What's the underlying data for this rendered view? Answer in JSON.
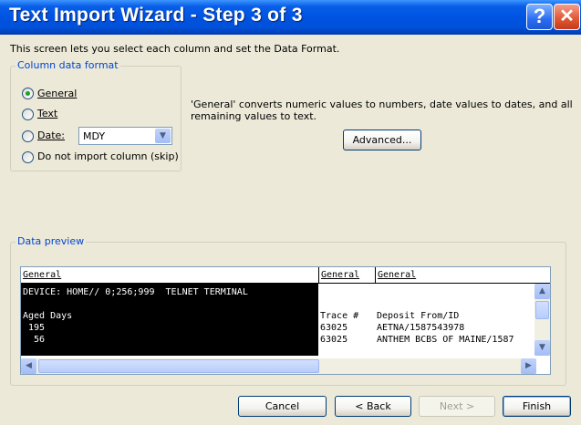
{
  "window": {
    "title": "Text Import Wizard - Step 3 of 3",
    "help_glyph": "?",
    "close_glyph": "✕"
  },
  "instruction": "This screen lets you select each column and set the Data Format.",
  "column_format": {
    "legend": "Column data format",
    "options": [
      {
        "label": "General",
        "selected": true
      },
      {
        "label": "Text",
        "selected": false
      },
      {
        "label": "Date:",
        "selected": false
      },
      {
        "label": "Do not import column (skip)",
        "selected": false
      }
    ],
    "date_format": "MDY"
  },
  "description": {
    "line1": "'General' converts numeric values to numbers, date values to dates, and all",
    "line2": "remaining values to text."
  },
  "advanced_label": "Advanced...",
  "preview": {
    "legend": "Data preview",
    "columns": [
      "General",
      "General",
      "General"
    ],
    "col1": [
      "DEVICE: HOME// 0;256;999  TELNET TERMINAL",
      "",
      "Aged Days",
      " 195",
      "  56"
    ],
    "col2": [
      "",
      "",
      "Trace #",
      "63025",
      "63025"
    ],
    "col3": [
      "",
      "",
      "Deposit From/ID",
      "AETNA/1587543978",
      "ANTHEM BCBS OF MAINE/1587"
    ]
  },
  "buttons": {
    "cancel": "Cancel",
    "back": "< Back",
    "next": "Next >",
    "finish": "Finish"
  },
  "colors": {
    "title_bar": "#0054e3",
    "selected_column": "#000000",
    "group_legend": "#0046d5"
  },
  "icons": {
    "help": "help-icon",
    "close": "close-icon",
    "dropdown": "chevron-down-icon",
    "scroll_up": "arrow-up-icon",
    "scroll_down": "arrow-down-icon",
    "scroll_left": "arrow-left-icon",
    "scroll_right": "arrow-right-icon"
  }
}
